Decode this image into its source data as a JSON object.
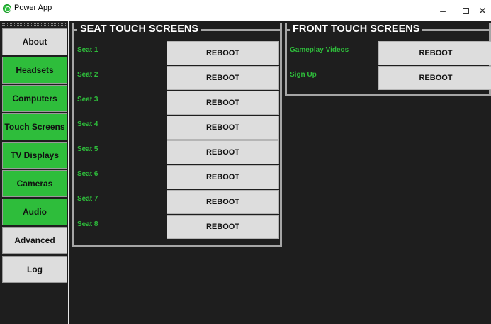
{
  "window": {
    "title": "Power App",
    "minimize": "–",
    "close": "✕"
  },
  "sidebar": {
    "items": [
      {
        "label": "About",
        "state": "gray"
      },
      {
        "label": "Headsets",
        "state": "green"
      },
      {
        "label": "Computers",
        "state": "green"
      },
      {
        "label": "Touch Screens",
        "state": "green"
      },
      {
        "label": "TV Displays",
        "state": "green"
      },
      {
        "label": "Cameras",
        "state": "green"
      },
      {
        "label": "Audio",
        "state": "green"
      },
      {
        "label": "Advanced",
        "state": "gray"
      },
      {
        "label": "Log",
        "state": "gray"
      }
    ]
  },
  "seat_group": {
    "title": "SEAT TOUCH SCREENS",
    "rows": [
      {
        "label": "Seat 1",
        "button": "REBOOT"
      },
      {
        "label": "Seat 2",
        "button": "REBOOT"
      },
      {
        "label": "Seat 3",
        "button": "REBOOT"
      },
      {
        "label": "Seat 4",
        "button": "REBOOT"
      },
      {
        "label": "Seat 5",
        "button": "REBOOT"
      },
      {
        "label": "Seat 6",
        "button": "REBOOT"
      },
      {
        "label": "Seat 7",
        "button": "REBOOT"
      },
      {
        "label": "Seat 8",
        "button": "REBOOT"
      }
    ]
  },
  "front_group": {
    "title": "FRONT TOUCH SCREENS",
    "rows": [
      {
        "label": "Gameplay Videos",
        "button": "REBOOT"
      },
      {
        "label": "Sign Up",
        "button": "REBOOT"
      }
    ]
  },
  "colors": {
    "accent_green": "#2ebd3b",
    "background_dark": "#1e1e1e",
    "button_gray": "#dddddd"
  }
}
